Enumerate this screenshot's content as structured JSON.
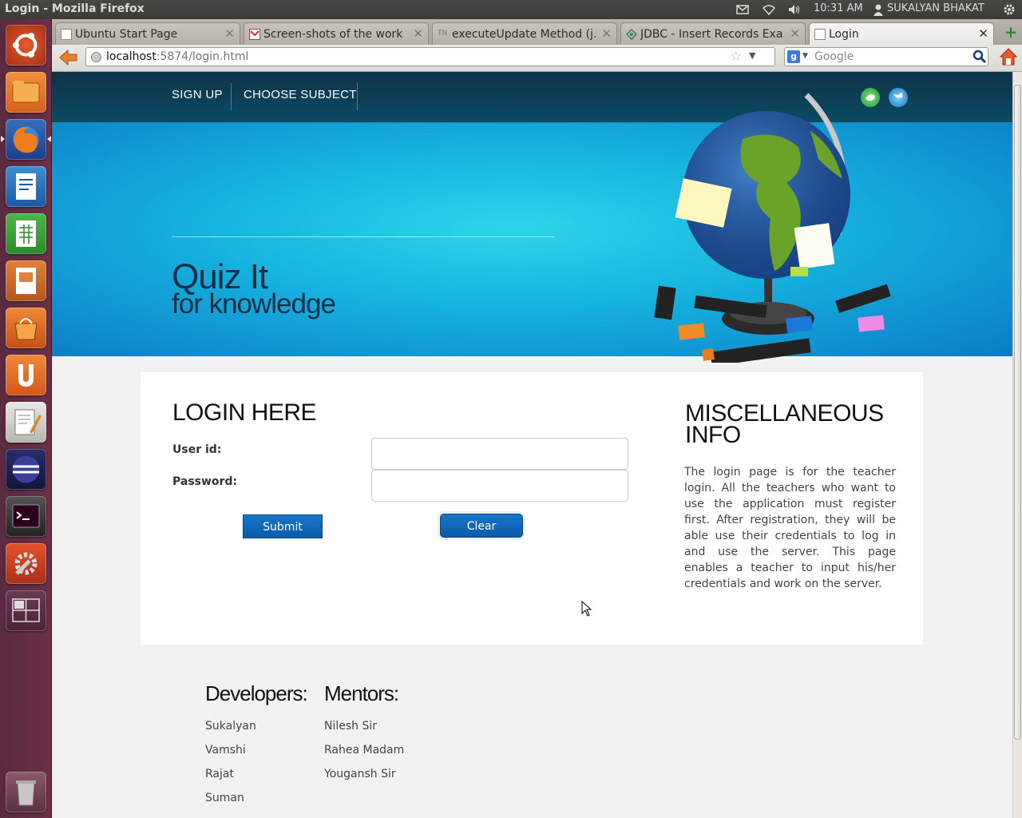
{
  "system": {
    "window_title": "Login - Mozilla Firefox",
    "time": "10:31 AM",
    "user": "SUKALYAN BHAKAT"
  },
  "launcher": {
    "items": [
      "dash-home",
      "files",
      "firefox",
      "writer",
      "calc",
      "impress",
      "software-center",
      "ubuntu-one",
      "text-editor",
      "eclipse",
      "terminal",
      "system-settings",
      "workspace-switcher",
      "trash"
    ]
  },
  "browser": {
    "tabs": [
      {
        "label": "Ubuntu Start Page",
        "icon": "blank-page-icon"
      },
      {
        "label": "Screen-shots of the work ...",
        "icon": "gmail-icon"
      },
      {
        "label": "executeUpdate Method (j...",
        "icon": "tn-icon"
      },
      {
        "label": "JDBC - Insert Records Exa...",
        "icon": "tutorialspoint-icon"
      },
      {
        "label": "Login",
        "icon": "blank-page-icon"
      }
    ],
    "url_host": "localhost",
    "url_path": ":5874/login.html",
    "search_placeholder": "Google",
    "search_engine_badge": "g"
  },
  "site": {
    "nav": [
      "SIGN UP",
      "CHOOSE SUBJECT"
    ],
    "hero_title": "Quiz It",
    "hero_subtitle": "for knowledge",
    "login": {
      "heading": "LOGIN HERE",
      "user_label": "User id:",
      "password_label": "Password:",
      "submit_label": "Submit",
      "clear_label": "Clear"
    },
    "misc": {
      "heading_line1": "MISCELLANEOUS",
      "heading_line2": "INFO",
      "text": "The login page is for the teacher login. All the teachers who want to use the application must register first. After registration, they will be able use their credentials to log in and use the server. This page enables a teacher to input his/her credentials and work on the server."
    },
    "footer": {
      "developers_heading": "Developers:",
      "developers": [
        "Sukalyan",
        "Vamshi",
        "Rajat",
        "Suman"
      ],
      "mentors_heading": "Mentors:",
      "mentors": [
        "Nilesh Sir",
        "Rahea Madam",
        "Yougansh Sir"
      ]
    }
  },
  "colors": {
    "header_bg": "#0c3f57",
    "hero_blue": "#17b6e0",
    "button_blue": "#0a5aa8",
    "launcher_bg": "#5a2a40"
  }
}
